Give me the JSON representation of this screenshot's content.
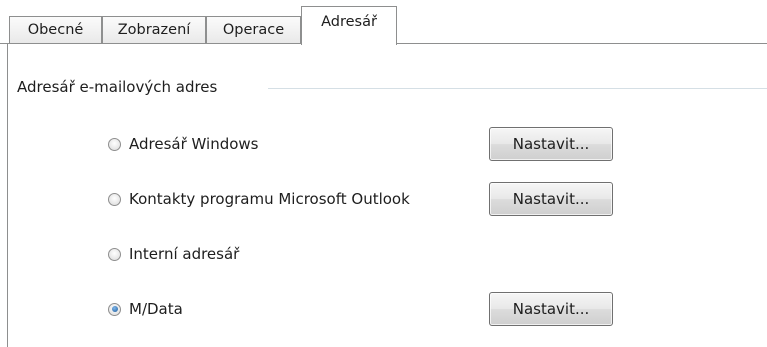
{
  "tabs": [
    {
      "label": "Obecné",
      "active": false
    },
    {
      "label": "Zobrazení",
      "active": false
    },
    {
      "label": "Operace",
      "active": false
    },
    {
      "label": "Adresář",
      "active": true
    }
  ],
  "group": {
    "title": "Adresář e-mailových adres",
    "options": [
      {
        "label": "Adresář Windows",
        "selected": false,
        "button": "Nastavit..."
      },
      {
        "label": "Kontakty programu Microsoft Outlook",
        "selected": false,
        "button": "Nastavit..."
      },
      {
        "label": "Interní adresář",
        "selected": false,
        "button": null
      },
      {
        "label": "M/Data",
        "selected": true,
        "button": "Nastavit..."
      }
    ]
  }
}
